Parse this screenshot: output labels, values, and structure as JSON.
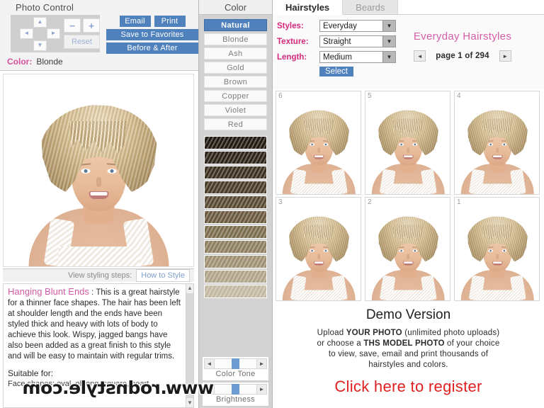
{
  "photo_control": {
    "title": "Photo Control",
    "pad": {
      "up": "▲",
      "down": "▼",
      "left": "◄",
      "right": "►"
    },
    "zoom_out": "−",
    "zoom_in": "+",
    "reset_label": "Reset",
    "email_label": "Email",
    "print_label": "Print",
    "save_favorites_label": "Save to Favorites",
    "before_after_label": "Before & After",
    "color_label": "Color:",
    "color_value": "Blonde"
  },
  "styling": {
    "view_steps_label": "View styling steps:",
    "how_to_style_label": "How to Style"
  },
  "description": {
    "title": "Hanging Blunt Ends",
    "separator": " : ",
    "body": "This is a great hairstyle for a thinner face shapes. The hair has been left at shoulder length and the ends have been styled thick and heavy with lots of body to achieve this look. Wispy, jagged bangs have also been added as a great finish to this style and will be easy to maintain with regular trims.",
    "suitable": "Suitable for:",
    "face_shapes": "Face shapes: oval, oblong, square, heart"
  },
  "color_panel": {
    "title": "Color",
    "items": [
      {
        "label": "Natural",
        "selected": true
      },
      {
        "label": "Blonde",
        "selected": false
      },
      {
        "label": "Ash",
        "selected": false
      },
      {
        "label": "Gold",
        "selected": false
      },
      {
        "label": "Brown",
        "selected": false
      },
      {
        "label": "Copper",
        "selected": false
      },
      {
        "label": "Violet",
        "selected": false
      },
      {
        "label": "Red",
        "selected": false
      }
    ],
    "swatches": [
      "#221b12",
      "#2e241a",
      "#3d3121",
      "#4b3c29",
      "#5a4a33",
      "#6b5a40",
      "#7d6d4f",
      "#8e7f60",
      "#9f9173",
      "#b1a589",
      "#c3b9a2"
    ],
    "sliders": [
      {
        "label": "Color Tone",
        "value": 44,
        "left_arrow": "◄",
        "right_arrow": "►"
      },
      {
        "label": "Brightness",
        "value": 44,
        "left_arrow": "◄",
        "right_arrow": "►"
      }
    ]
  },
  "right_panel": {
    "tabs": [
      {
        "label": "Hairstyles",
        "active": true
      },
      {
        "label": "Beards",
        "active": false
      }
    ],
    "filters": [
      {
        "label": "Styles:",
        "value": "Everyday"
      },
      {
        "label": "Texture:",
        "value": "Straight"
      },
      {
        "label": "Length:",
        "value": "Medium"
      }
    ],
    "select_label": "Select",
    "caret": "▼",
    "category_title": "Everyday Hairstyles",
    "pager": {
      "prev": "◄",
      "next": "►",
      "text": "page 1 of 294"
    },
    "grid": {
      "rows": [
        [
          {
            "num": "6"
          },
          {
            "num": "5"
          },
          {
            "num": "4"
          }
        ],
        [
          {
            "num": "3"
          },
          {
            "num": "2"
          },
          {
            "num": "1"
          }
        ]
      ]
    },
    "demo": {
      "title": "Demo Version",
      "line1_a": "Upload ",
      "line1_b": "YOUR PHOTO",
      "line1_c": " (unlimited photo uploads)",
      "line2_a": "or choose a ",
      "line2_b": "THS MODEL PHOTO",
      "line2_c": " of your choice",
      "line3": "to view, save, email and print thousands of",
      "line4": "hairstyles and colors.",
      "cta": "Click here to register"
    }
  },
  "watermark": {
    "text": "www.rodnstyle.com"
  },
  "colors": {
    "accent_blue": "#4f81bd",
    "accent_pink": "#d6297e",
    "title_pink": "#d45fa8",
    "cta_red": "#e12020"
  }
}
